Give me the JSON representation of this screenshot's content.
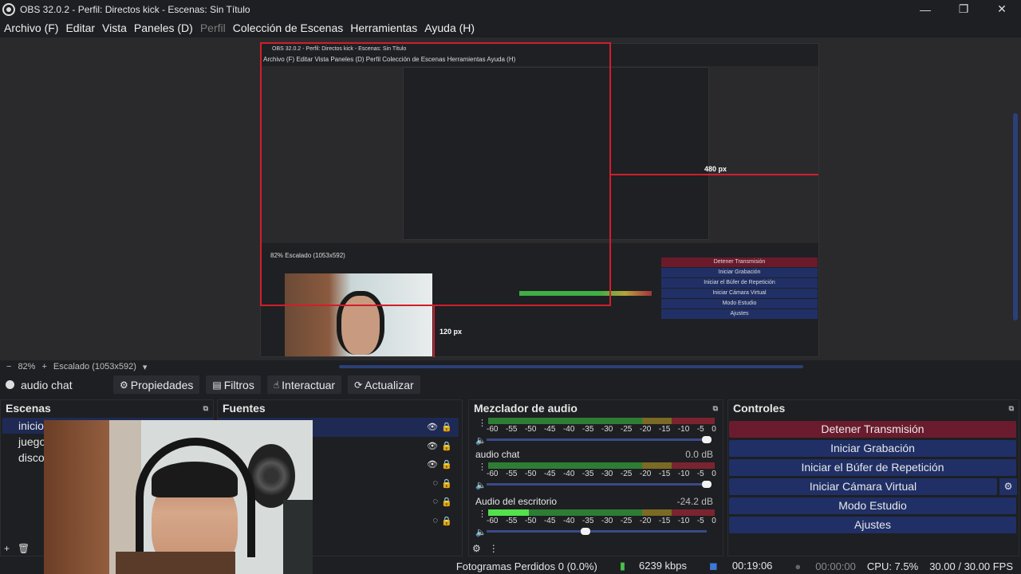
{
  "window": {
    "title": "OBS 32.0.2 - Perfil: Directos kick - Escenas: Sin Título",
    "controls": [
      "—",
      "❐",
      "✕"
    ]
  },
  "menu": [
    "Archivo (F)",
    "Editar",
    "Vista",
    "Paneles (D)",
    "Perfil",
    "Colección de Escenas",
    "Herramientas",
    "Ayuda (H)"
  ],
  "menu_disabled": "Perfil",
  "nested_preview": {
    "title": "OBS 32.0.2 - Perfil: Directos kick - Escenas: Sin Título",
    "menu": "Archivo (F)  Editar  Vista  Paneles (D)  Perfil  Colección de Escenas  Herramientas  Ayuda (H)",
    "zoom": "82%   Escalado (1053x592)",
    "label_480": "480 px",
    "label_120": "120 px",
    "controls": [
      "Detener Transmisión",
      "Iniciar Grabación",
      "Iniciar el Búfer de Repetición",
      "Iniciar Cámara Virtual",
      "Modo Estudio",
      "Ajustes"
    ]
  },
  "zoombar": {
    "minus": "−",
    "zoom": "82%",
    "plus": "+",
    "scale": "Escalado (1053x592)",
    "dropdown": "▾"
  },
  "source_toolbar": {
    "source_name": "audio chat",
    "buttons": [
      {
        "icon": "⚙",
        "label": "Propiedades"
      },
      {
        "icon": "▤",
        "label": "Filtros"
      },
      {
        "icon": "☝",
        "label": "Interactuar"
      },
      {
        "icon": "⟳",
        "label": "Actualizar"
      }
    ]
  },
  "scenes": {
    "title": "Escenas",
    "items": [
      "inicio",
      "juego",
      "disco"
    ],
    "selected": 0
  },
  "sources": {
    "title": "Fuentes",
    "rows": 7
  },
  "mixer": {
    "title": "Mezclador de audio",
    "scale": [
      "-60",
      "-55",
      "-50",
      "-45",
      "-40",
      "-35",
      "-30",
      "-25",
      "-20",
      "-15",
      "-10",
      "-5",
      "0"
    ],
    "channels": [
      {
        "name": "",
        "db": "",
        "level": 0.0,
        "volume": 1.0
      },
      {
        "name": "audio chat",
        "db": "0.0 dB",
        "level": 0.0,
        "volume": 1.0
      },
      {
        "name": "Audio del escritorio",
        "db": "-24.2 dB",
        "level": 0.18,
        "volume": 0.45
      }
    ]
  },
  "controls": {
    "title": "Controles",
    "stop_stream": "Detener Transmisión",
    "start_recording": "Iniciar Grabación",
    "replay_buffer": "Iniciar el Búfer de Repetición",
    "virtual_cam": "Iniciar Cámara Virtual",
    "studio_mode": "Modo Estudio",
    "settings": "Ajustes"
  },
  "status": {
    "dropped_frames": "Fotogramas Perdidos 0 (0.0%)",
    "bitrate": "6239 kbps",
    "stream_time": "00:19:06",
    "rec_time": "00:00:00",
    "cpu": "CPU: 7.5%",
    "fps": "30.00 / 30.00 FPS"
  },
  "colors": {
    "accent_blue": "#203066",
    "stop_red": "#6a1c2e",
    "guide_red": "#d11e2b"
  }
}
